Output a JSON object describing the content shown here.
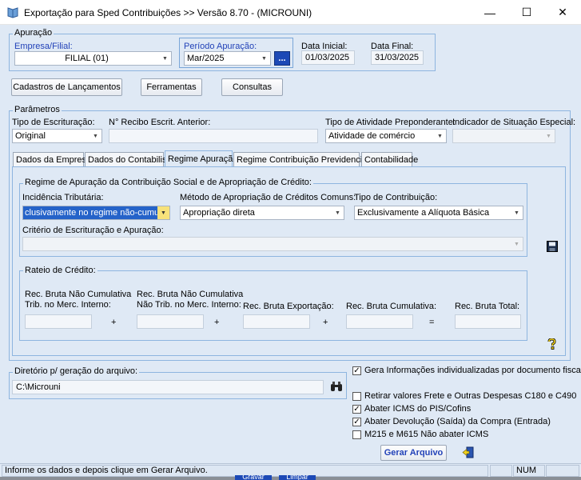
{
  "window": {
    "title": "Exportação para Sped Contribuições >> Versão 8.70 - (MICROUNI)",
    "minimize": "—",
    "maximize": "☐",
    "close": "✕"
  },
  "apuracao": {
    "legend": "Apuração",
    "empresa_label": "Empresa/Filial:",
    "empresa_value": "FILIAL (01)",
    "periodo_label": "Período Apuração:",
    "periodo_value": "Mar/2025",
    "periodo_button": "...",
    "data_inicial_label": "Data Inicial:",
    "data_inicial_value": "01/03/2025",
    "data_final_label": "Data Final:",
    "data_final_value": "31/03/2025"
  },
  "toolbar": {
    "cadastros": "Cadastros de Lançamentos",
    "ferramentas": "Ferramentas",
    "consultas": "Consultas"
  },
  "parametros": {
    "legend": "Parâmetros",
    "tipo_escrituracao_label": "Tipo de Escrituração:",
    "tipo_escrituracao_value": "Original",
    "recibo_label": "N° Recibo Escrit. Anterior:",
    "recibo_value": "",
    "atividade_label": "Tipo de Atividade Preponderante:",
    "atividade_value": "Atividade de comércio",
    "situacao_label": "Indicador de Situação Especial:",
    "situacao_value": ""
  },
  "tabs": [
    {
      "label": "Dados da Empresa"
    },
    {
      "label": "Dados do Contabilista"
    },
    {
      "label": "Regime Apuração"
    },
    {
      "label": "Regime Contribuição Previdenciária"
    },
    {
      "label": "Contabilidade"
    }
  ],
  "regime": {
    "legend": "Regime de Apuração da Contribuição Social e de Apropriação de Crédito:",
    "incidencia_label": "Incidência Tributária:",
    "incidencia_value": "clusivamente no regime não-cumulativo",
    "metodo_label": "Método de Apropriação de Créditos Comuns:",
    "metodo_value": "Apropriação direta",
    "tipo_contrib_label": "Tipo de Contribuição:",
    "tipo_contrib_value": "Exclusivamente a Alíquota Básica",
    "criterio_label": "Critério de Escrituração e Apuração:",
    "criterio_value": ""
  },
  "rateio": {
    "legend": "Rateio de Crédito:",
    "rb_nc_int_1": "Rec. Bruta Não Cumulativa",
    "rb_nc_int_2": "Trib. no Merc. Interno:",
    "rb_nc_ntrib_1": "Rec. Bruta Não Cumulativa",
    "rb_nc_ntrib_2": "Não Trib. no Merc. Interno:",
    "rb_export": "Rec. Bruta Exportação:",
    "rb_cumul": "Rec. Bruta Cumulativa:",
    "rb_total": "Rec. Bruta Total:",
    "op_plus": "+",
    "op_eq": "="
  },
  "diretorio": {
    "legend": "Diretório p/ geração do arquivo:",
    "value": "C:\\Microuni"
  },
  "options": [
    {
      "label": "Gera Informações individualizadas por documento fiscal",
      "checked": true
    },
    {
      "label": "Retirar valores Frete e Outras Despesas C180 e C490",
      "checked": false
    },
    {
      "label": "Abater ICMS do PIS/Cofins",
      "checked": true
    },
    {
      "label": "Abater Devolução (Saída) da Compra (Entrada)",
      "checked": true
    },
    {
      "label": "M215 e M615 Não abater ICMS",
      "checked": false
    }
  ],
  "gerar_button": "Gerar Arquivo",
  "status": {
    "message": "Informe os dados e depois clique em Gerar Arquivo.",
    "num": "NUM"
  },
  "behind": {
    "gravar": "Gravar",
    "limpar": "Limpar"
  },
  "colors": {
    "accent": "#2242b8",
    "window_bg": "#dfe9f5",
    "group_border": "#8eb5df"
  }
}
